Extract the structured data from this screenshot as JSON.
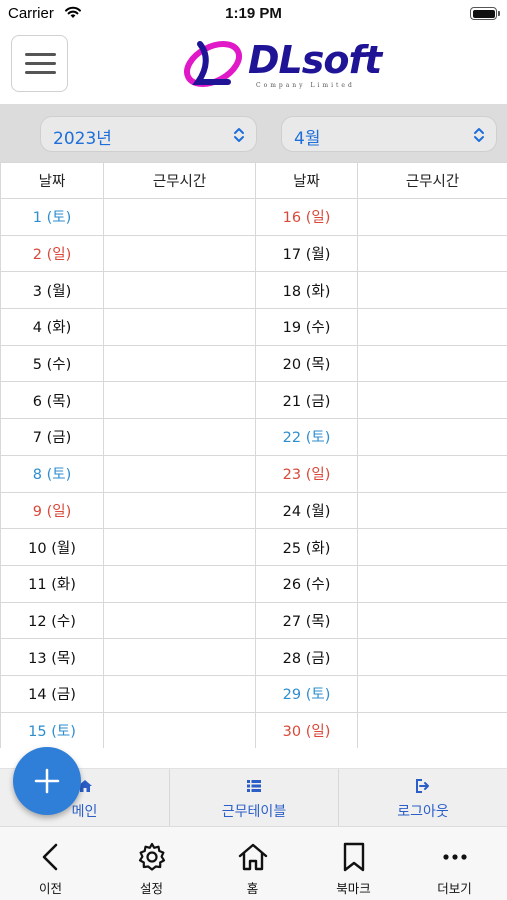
{
  "status_bar": {
    "carrier": "Carrier",
    "time": "1:19 PM"
  },
  "header": {
    "logo_text": "DLsoft",
    "logo_subtitle": "Company Limited",
    "colors": {
      "logo_text": "#1f1396",
      "logo_mark": "#e018c8"
    }
  },
  "selectors": {
    "year": {
      "value": "2023년"
    },
    "month": {
      "value": "4월"
    }
  },
  "table": {
    "headers": [
      "날짜",
      "근무시간",
      "날짜",
      "근무시간"
    ],
    "rows": [
      {
        "left": {
          "date": "1 (토)",
          "type": "sat",
          "hours": ""
        },
        "right": {
          "date": "16 (일)",
          "type": "sun",
          "hours": ""
        }
      },
      {
        "left": {
          "date": "2 (일)",
          "type": "sun",
          "hours": ""
        },
        "right": {
          "date": "17 (월)",
          "type": "wd",
          "hours": ""
        }
      },
      {
        "left": {
          "date": "3 (월)",
          "type": "wd",
          "hours": ""
        },
        "right": {
          "date": "18 (화)",
          "type": "wd",
          "hours": ""
        }
      },
      {
        "left": {
          "date": "4 (화)",
          "type": "wd",
          "hours": ""
        },
        "right": {
          "date": "19 (수)",
          "type": "wd",
          "hours": ""
        }
      },
      {
        "left": {
          "date": "5 (수)",
          "type": "wd",
          "hours": ""
        },
        "right": {
          "date": "20 (목)",
          "type": "wd",
          "hours": ""
        }
      },
      {
        "left": {
          "date": "6 (목)",
          "type": "wd",
          "hours": ""
        },
        "right": {
          "date": "21 (금)",
          "type": "wd",
          "hours": ""
        }
      },
      {
        "left": {
          "date": "7 (금)",
          "type": "wd",
          "hours": ""
        },
        "right": {
          "date": "22 (토)",
          "type": "sat",
          "hours": ""
        }
      },
      {
        "left": {
          "date": "8 (토)",
          "type": "sat",
          "hours": ""
        },
        "right": {
          "date": "23 (일)",
          "type": "sun",
          "hours": ""
        }
      },
      {
        "left": {
          "date": "9 (일)",
          "type": "sun",
          "hours": ""
        },
        "right": {
          "date": "24 (월)",
          "type": "wd",
          "hours": ""
        }
      },
      {
        "left": {
          "date": "10 (월)",
          "type": "wd",
          "hours": ""
        },
        "right": {
          "date": "25 (화)",
          "type": "wd",
          "hours": ""
        }
      },
      {
        "left": {
          "date": "11 (화)",
          "type": "wd",
          "hours": ""
        },
        "right": {
          "date": "26 (수)",
          "type": "wd",
          "hours": ""
        }
      },
      {
        "left": {
          "date": "12 (수)",
          "type": "wd",
          "hours": ""
        },
        "right": {
          "date": "27 (목)",
          "type": "wd",
          "hours": ""
        }
      },
      {
        "left": {
          "date": "13 (목)",
          "type": "wd",
          "hours": ""
        },
        "right": {
          "date": "28 (금)",
          "type": "wd",
          "hours": ""
        }
      },
      {
        "left": {
          "date": "14 (금)",
          "type": "wd",
          "hours": ""
        },
        "right": {
          "date": "29 (토)",
          "type": "sat",
          "hours": ""
        }
      },
      {
        "left": {
          "date": "15 (토)",
          "type": "sat",
          "hours": ""
        },
        "right": {
          "date": "30 (일)",
          "type": "sun",
          "hours": ""
        }
      }
    ],
    "colors": {
      "saturday": "#2e8ecf",
      "sunday": "#d9493a",
      "weekday": "#111111"
    }
  },
  "tab_bar": {
    "items": [
      {
        "label": "메인",
        "icon": "home-icon"
      },
      {
        "label": "근무테이블",
        "icon": "list-icon"
      },
      {
        "label": "로그아웃",
        "icon": "logout-icon"
      }
    ],
    "color": "#2b5fc7"
  },
  "fab": {
    "icon": "plus-icon",
    "color": "#2f7fd9"
  },
  "toolbar": {
    "items": [
      {
        "label": "이전",
        "icon": "chevron-left-icon"
      },
      {
        "label": "설정",
        "icon": "gear-icon"
      },
      {
        "label": "홈",
        "icon": "home-icon"
      },
      {
        "label": "북마크",
        "icon": "bookmark-icon"
      },
      {
        "label": "더보기",
        "icon": "more-icon"
      }
    ]
  }
}
